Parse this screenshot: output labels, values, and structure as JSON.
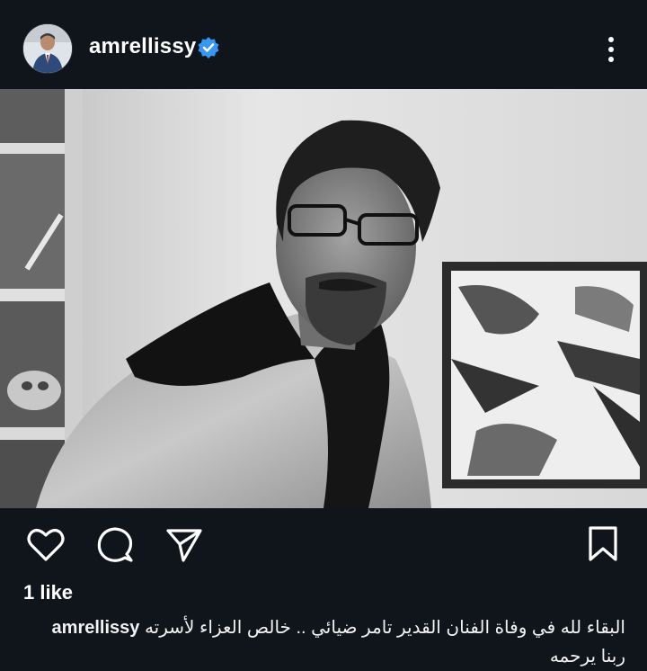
{
  "post": {
    "username": "amrellissy",
    "verified": true,
    "likes_label": "1 like",
    "caption_line1": "البقاء لله في وفاة الفنان القدير تامر ضيائي .. خالص العزاء لأسرته",
    "caption_line2": "ربنا يرحمه"
  },
  "icons": {
    "header": [
      "verified-badge-icon",
      "more-options-icon"
    ],
    "actions": [
      "heart-icon",
      "comment-icon",
      "share-icon",
      "bookmark-icon"
    ]
  },
  "colors": {
    "background": "#0f151b",
    "text": "#ffffff",
    "verified": "#3897f0"
  }
}
